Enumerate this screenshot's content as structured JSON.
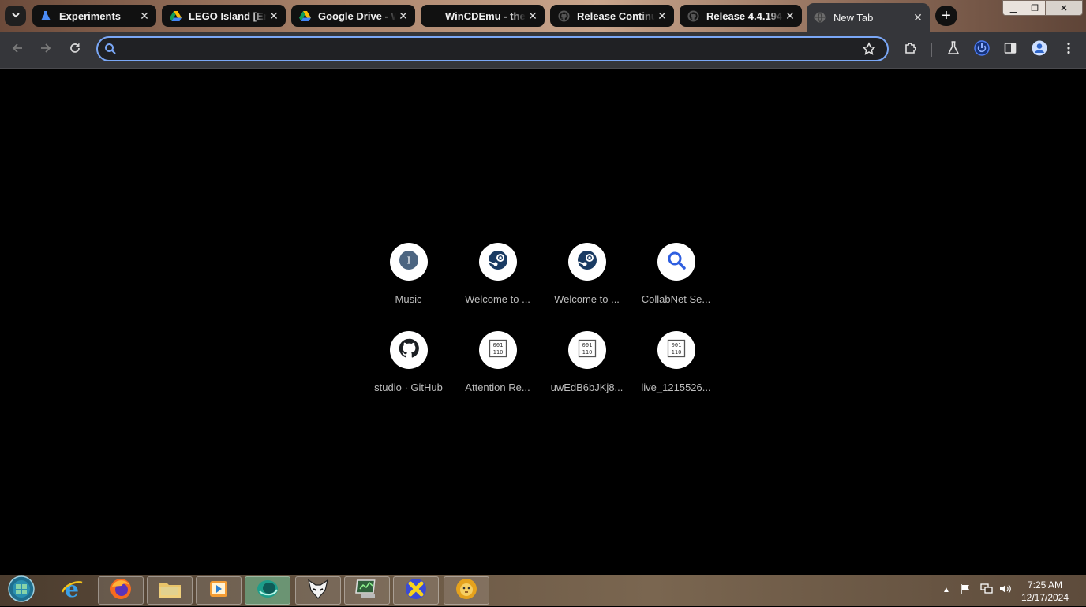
{
  "browser": {
    "tabs": [
      {
        "title": "Experiments",
        "icon": "experiments-icon",
        "active": false
      },
      {
        "title": "LEGO Island [Eng",
        "icon": "google-drive-icon",
        "active": false
      },
      {
        "title": "Google Drive - W",
        "icon": "google-drive-icon",
        "active": false
      },
      {
        "title": "WinCDEmu - the",
        "icon": "wincdemu-icon",
        "active": false
      },
      {
        "title": "Release Continu",
        "icon": "github-icon",
        "active": false
      },
      {
        "title": "Release 4.4.194",
        "icon": "github-icon",
        "active": false
      },
      {
        "title": "New Tab",
        "icon": "globe-icon",
        "active": true
      }
    ],
    "omnibox": {
      "value": "",
      "placeholder": ""
    }
  },
  "shortcuts": [
    {
      "label": "Music",
      "icon": "music-icon"
    },
    {
      "label": "Welcome to ...",
      "icon": "steam-icon"
    },
    {
      "label": "Welcome to ...",
      "icon": "steam-icon"
    },
    {
      "label": "CollabNet Se...",
      "icon": "search-icon"
    },
    {
      "label": "studio · GitHub",
      "icon": "github-icon"
    },
    {
      "label": "Attention Re...",
      "icon": "binary-file-icon"
    },
    {
      "label": "uwEdB6bJKj8...",
      "icon": "binary-file-icon"
    },
    {
      "label": "live_1215526...",
      "icon": "binary-file-icon"
    }
  ],
  "taskbar": {
    "apps": [
      "start-orb",
      "internet-explorer",
      "firefox",
      "file-explorer",
      "media-player",
      "browser-app",
      "foobar",
      "network-monitor",
      "x-app",
      "lion-app"
    ],
    "clock": {
      "time": "7:25 AM",
      "date": "12/17/2024"
    }
  },
  "colors": {
    "accent": "#7aa7f6",
    "toolbar": "#35363a",
    "background": "#000000"
  }
}
